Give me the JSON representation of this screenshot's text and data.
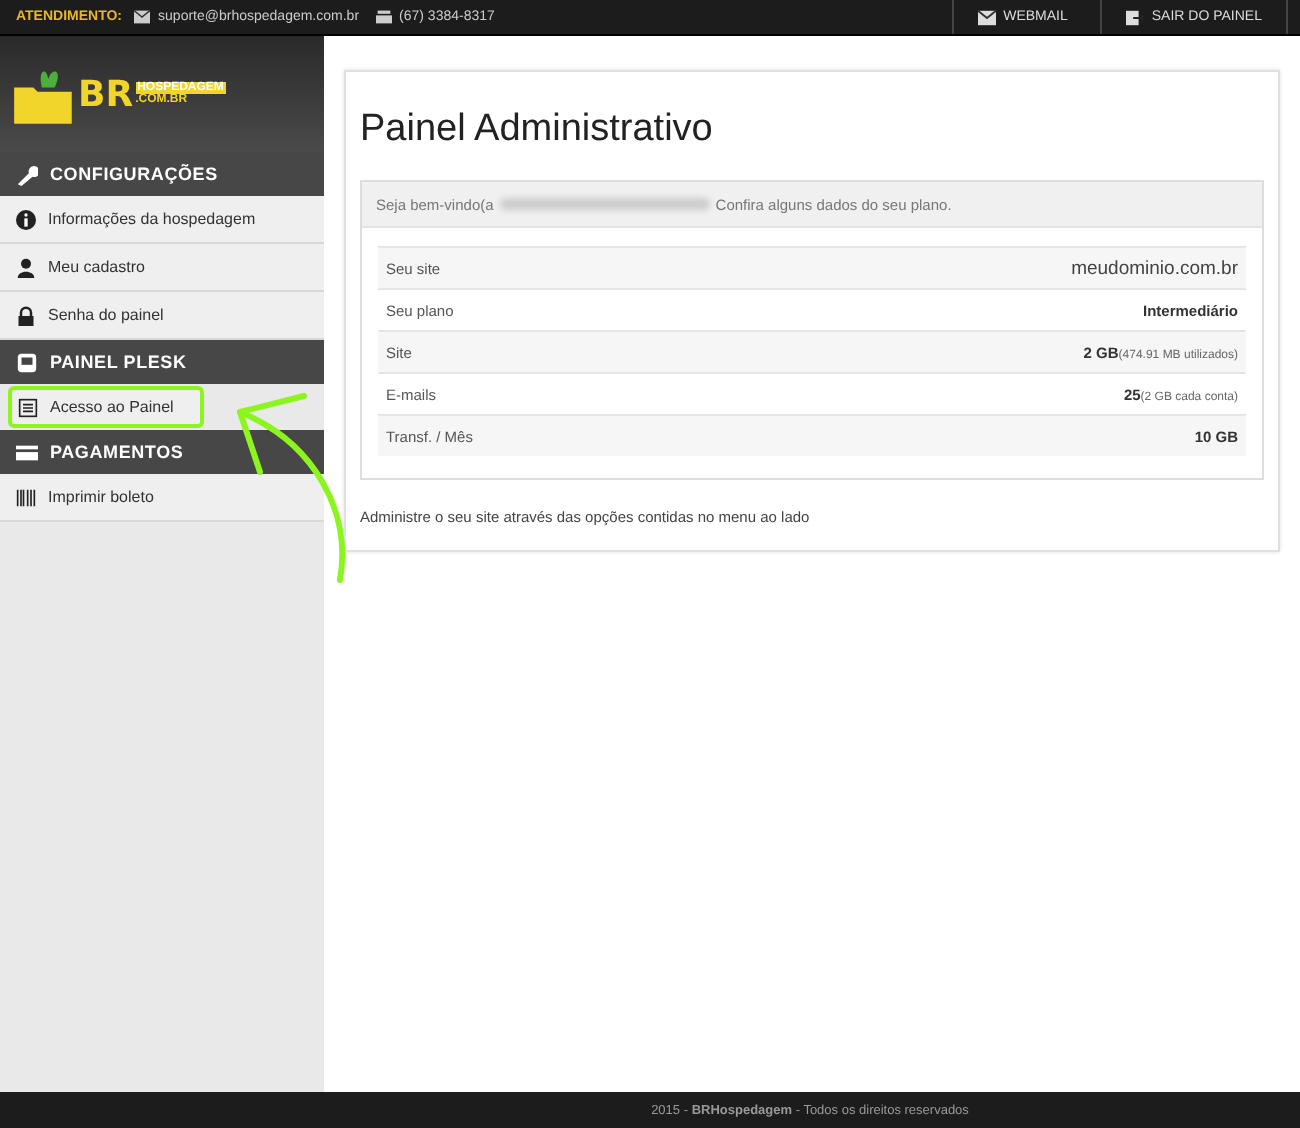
{
  "topbar": {
    "label": "ATENDIMENTO:",
    "email": "suporte@brhospedagem.com.br",
    "phone": "(67) 3384-8317",
    "buttons": [
      {
        "label": "WEBMAIL",
        "kind": "mail"
      },
      {
        "label": "SAIR DO PAINEL",
        "kind": "exit"
      }
    ]
  },
  "logo": {
    "big": "BR",
    "top": "HOSPEDAGEM",
    "bottom": ".COM.BR"
  },
  "sidebar": [
    {
      "title": "CONFIGURAÇÕES",
      "kind": "wrench",
      "items": [
        {
          "label": "Informações da hospedagem",
          "kind": "info",
          "highlighted": false
        },
        {
          "label": "Meu cadastro",
          "kind": "user",
          "highlighted": false
        },
        {
          "label": "Senha do painel",
          "kind": "lock",
          "highlighted": false
        }
      ]
    },
    {
      "title": "PAINEL PLESK",
      "kind": "monitor",
      "items": [
        {
          "label": "Acesso ao Painel",
          "kind": "list",
          "highlighted": true
        }
      ]
    },
    {
      "title": "PAGAMENTOS",
      "kind": "card",
      "items": [
        {
          "label": "Imprimir boleto",
          "kind": "barcode",
          "highlighted": false
        }
      ]
    }
  ],
  "main": {
    "title": "Painel Administrativo",
    "welcome_before": "Seja bem-vindo(a",
    "welcome_after": "Confira alguns dados do seu plano.",
    "rows": [
      {
        "label": "Seu site",
        "value": "meudominio.com.br",
        "kind": "plain"
      },
      {
        "label": "Seu plano",
        "value": "Intermediário",
        "kind": "bold"
      },
      {
        "label": "Site",
        "value": "2 GB",
        "note": "(474.91 MB utilizados)",
        "kind": "bold"
      },
      {
        "label": "E-mails",
        "value": "25",
        "note": "(2 GB cada conta)",
        "kind": "bold"
      },
      {
        "label": "Transf. / Mês",
        "value": "10 GB",
        "kind": "bold"
      }
    ],
    "footer_text": "Administre o seu site através das opções contidas no menu ao lado"
  },
  "footer": "2015 - **BRHospedagem** - Todos os direitos reservados"
}
